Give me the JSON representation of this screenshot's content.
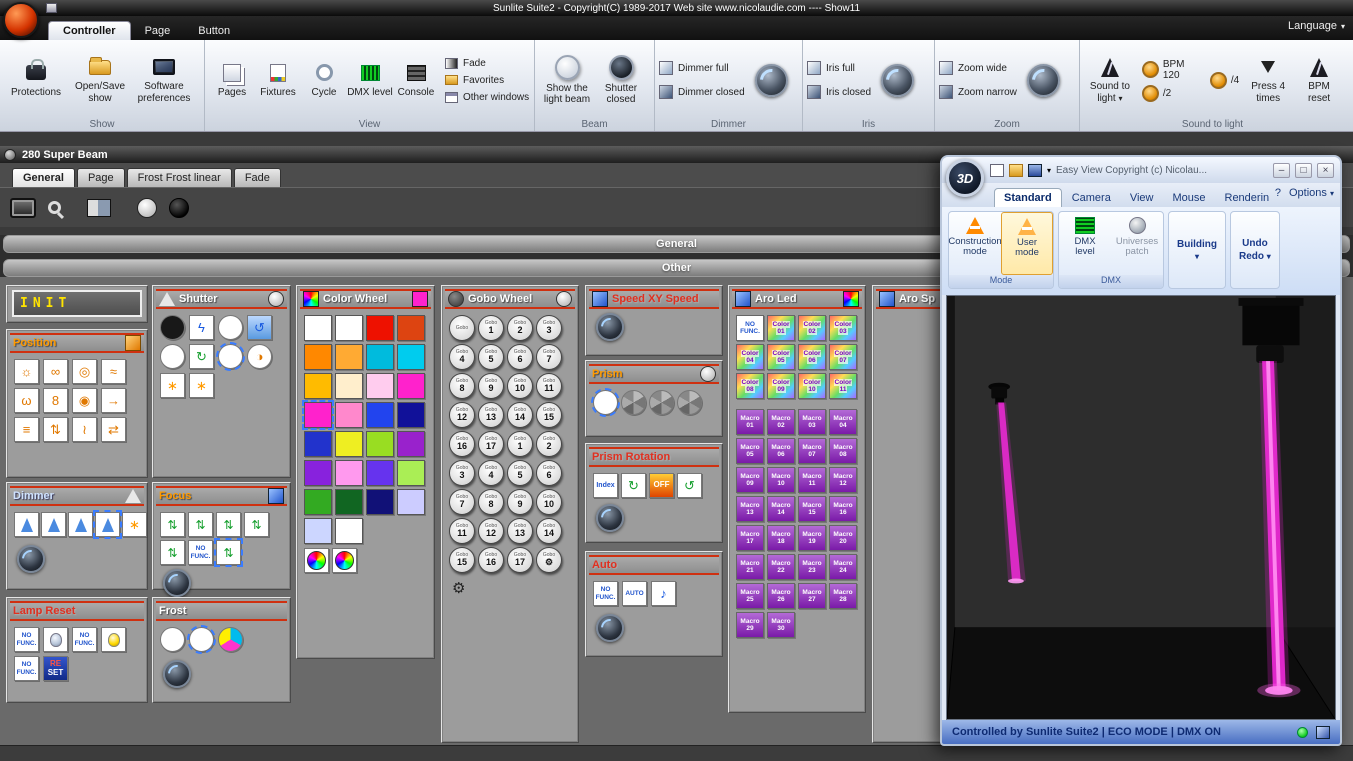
{
  "ui": {
    "caret": "▾"
  },
  "window": {
    "title": "Sunlite Suite2 - Copyright(C) 1989-2017    Web site www.nicolaudie.com ---- Show11"
  },
  "menubar": {
    "tabs": [
      {
        "label": "Controller",
        "active": true
      },
      {
        "label": "Page"
      },
      {
        "label": "Button"
      }
    ],
    "language": "Language"
  },
  "ribbon": {
    "show": {
      "label": "Show",
      "protections": "Protections",
      "open_save": "Open/Save show",
      "preferences": "Software preferences"
    },
    "view": {
      "label": "View",
      "pages": "Pages",
      "fixtures": "Fixtures",
      "cycle": "Cycle",
      "dmx_level": "DMX level",
      "console": "Console",
      "fade": "Fade",
      "favorites": "Favorites",
      "other_windows": "Other windows"
    },
    "beam": {
      "label": "Beam",
      "show_beam": "Show the light beam",
      "shutter_closed": "Shutter closed"
    },
    "dimmer": {
      "label": "Dimmer",
      "full": "Dimmer full",
      "closed": "Dimmer closed"
    },
    "iris": {
      "label": "Iris",
      "full": "Iris full",
      "closed": "Iris closed"
    },
    "zoom": {
      "label": "Zoom",
      "wide": "Zoom wide",
      "narrow": "Zoom narrow"
    },
    "sound": {
      "label": "Sound to light",
      "sound_to_light": "Sound to light",
      "bpm": "BPM 120",
      "div2": "/2",
      "div4": "/4",
      "press4": "Press 4 times",
      "bpm_reset": "BPM reset"
    }
  },
  "fixture": {
    "title": "280 Super Beam",
    "tabs": [
      {
        "label": "General",
        "active": true
      },
      {
        "label": "Page"
      },
      {
        "label": "Frost Frost linear"
      },
      {
        "label": "Fade"
      }
    ]
  },
  "sections": {
    "general": "General",
    "other": "Other"
  },
  "board": {
    "init": {
      "title": "INIT"
    },
    "position": {
      "title": "Position",
      "presets": [
        "☼",
        "∞",
        "◎",
        "≈",
        "ω",
        "8",
        "◉",
        "→",
        "≡",
        "⇅",
        "≀",
        "⇄"
      ]
    },
    "shutter": {
      "title": "Shutter",
      "cells": [
        {
          "name": "shutter-closed",
          "c": "#181818",
          "cls": "round"
        },
        {
          "name": "strobe-button",
          "g": "ϟ",
          "cls": "fg-blue"
        },
        {
          "name": "shutter-open",
          "c": "#ffffff",
          "cls": "round"
        },
        {
          "name": "strobe-random",
          "g": "↺",
          "cls": "fg-blue bg-blue"
        },
        {
          "name": "shutter-open-b",
          "c": "#ffffff",
          "cls": "round"
        },
        {
          "name": "strobe-sync",
          "g": "↻",
          "cls": "fg-green"
        },
        {
          "name": "shutter-open-selected",
          "c": "#ffffff",
          "cls": "round",
          "sel": true
        },
        {
          "name": "shutter-split",
          "c": "#ffffff",
          "cls": "round",
          "g": "◑"
        }
      ],
      "extra": [
        {
          "name": "shutter-pulse-open",
          "g": "∗",
          "cls": "fg-amber"
        },
        {
          "name": "shutter-pulse-close",
          "g": "∗",
          "cls": "fg-amber"
        }
      ]
    },
    "dimmer": {
      "title": "Dimmer",
      "cells": [
        {
          "name": "dimmer-beam-1",
          "cls": "beam"
        },
        {
          "name": "dimmer-beam-2",
          "cls": "beam"
        },
        {
          "name": "dimmer-beam-3",
          "cls": "beam"
        },
        {
          "name": "dimmer-beam-selected",
          "cls": "beam",
          "sel": true
        },
        {
          "name": "dimmer-strobe",
          "g": "∗",
          "cls": "fg-amber"
        }
      ]
    },
    "focus": {
      "title": "Focus",
      "cells": [
        {
          "name": "focus-1",
          "g": "⇅",
          "cls": "fic"
        },
        {
          "name": "focus-2",
          "g": "⇅",
          "cls": "fic"
        },
        {
          "name": "focus-3",
          "g": "⇅",
          "cls": "fic"
        },
        {
          "name": "focus-4",
          "g": "⇅",
          "cls": "fic"
        },
        {
          "name": "focus-5",
          "g": "⇅",
          "cls": "fic"
        },
        {
          "name": "focus-no-func",
          "l1": "NO",
          "l2": "FUNC."
        },
        {
          "name": "focus-selected",
          "g": "⇅",
          "cls": "fic",
          "sel": true
        }
      ]
    },
    "lamp_reset": {
      "title": "Lamp Reset",
      "cells": [
        {
          "name": "lamp-no-func-1",
          "l1": "NO",
          "l2": "FUNC."
        },
        {
          "name": "lamp-off-button",
          "cls": "bulb-dim"
        },
        {
          "name": "lamp-no-func-2",
          "l1": "NO",
          "l2": "FUNC."
        },
        {
          "name": "lamp-on-button",
          "cls": "bulb"
        },
        {
          "name": "lamp-no-func-3",
          "l1": "NO",
          "l2": "FUNC."
        },
        {
          "name": "reset-button",
          "l1": "RE",
          "l2": "SET",
          "cls": "reset"
        }
      ]
    },
    "frost": {
      "title": "Frost",
      "cells": [
        {
          "name": "frost-open",
          "c": "#ffffff",
          "cls": "round"
        },
        {
          "name": "frost-on-selected",
          "c": "#ffffff",
          "cls": "round",
          "sel": true
        },
        {
          "name": "frost-cmy",
          "cls": "cmy round"
        }
      ]
    },
    "color_wheel": {
      "title": "Color Wheel",
      "cells": [
        {
          "name": "color-01",
          "c": "#ffffff"
        },
        {
          "name": "color-02",
          "c": "#ffffff"
        },
        {
          "name": "color-03",
          "c": "#ee1100"
        },
        {
          "name": "color-04",
          "c": "#dd4411"
        },
        {
          "name": "color-05",
          "c": "#ff8800"
        },
        {
          "name": "color-06",
          "c": "#ffaa33"
        },
        {
          "name": "color-07",
          "c": "#00bbdd"
        },
        {
          "name": "color-08",
          "c": "#00ccee"
        },
        {
          "name": "color-09",
          "c": "#ffbb00"
        },
        {
          "name": "color-10",
          "c": "#ffeecc"
        },
        {
          "name": "color-11",
          "c": "#ffccee"
        },
        {
          "name": "color-12",
          "c": "#ff22cc"
        },
        {
          "name": "color-13-selected",
          "c": "#ff22cc",
          "sel": true
        },
        {
          "name": "color-14",
          "c": "#ff88cc"
        },
        {
          "name": "color-15",
          "c": "#2244ee"
        },
        {
          "name": "color-16",
          "c": "#111199"
        },
        {
          "name": "color-17",
          "c": "#2233cc"
        },
        {
          "name": "color-18",
          "c": "#eeee22"
        },
        {
          "name": "color-19",
          "c": "#99dd22"
        },
        {
          "name": "color-20",
          "c": "#9922cc"
        },
        {
          "name": "color-21",
          "c": "#8822dd"
        },
        {
          "name": "color-22",
          "c": "#ff99ee"
        },
        {
          "name": "color-23",
          "c": "#6633ee"
        },
        {
          "name": "color-24",
          "c": "#aaee55"
        },
        {
          "name": "color-25",
          "c": "#33aa22"
        },
        {
          "name": "color-26",
          "c": "#116622"
        },
        {
          "name": "color-27",
          "c": "#111177"
        },
        {
          "name": "color-28",
          "c": "#ccccff"
        },
        {
          "name": "color-29",
          "c": "#ccd6ff"
        },
        {
          "name": "color-30",
          "c": "#ffffff"
        }
      ],
      "wheels": [
        {
          "name": "rainbow-wheel-1",
          "cls": "wheel"
        },
        {
          "name": "rainbow-wheel-2",
          "cls": "wheel"
        }
      ]
    },
    "gobo_wheel": {
      "title": "Gobo Wheel",
      "knob_text": "Gobo",
      "gear": "⚙",
      "knobs": [
        {
          "n": ""
        },
        {
          "n": "1"
        },
        {
          "n": "2"
        },
        {
          "n": "3"
        },
        {
          "n": "4"
        },
        {
          "n": "5"
        },
        {
          "n": "6"
        },
        {
          "n": "7"
        },
        {
          "n": "8"
        },
        {
          "n": "9"
        },
        {
          "n": "10"
        },
        {
          "n": "11"
        },
        {
          "n": "12"
        },
        {
          "n": "13"
        },
        {
          "n": "14"
        },
        {
          "n": "15"
        },
        {
          "n": "16"
        },
        {
          "n": "17"
        },
        {
          "n": "1"
        },
        {
          "n": "2"
        },
        {
          "n": "3"
        },
        {
          "n": "4"
        },
        {
          "n": "5"
        },
        {
          "n": "6"
        },
        {
          "n": "7"
        },
        {
          "n": "8"
        },
        {
          "n": "9"
        },
        {
          "n": "10"
        },
        {
          "n": "11"
        },
        {
          "n": "12"
        },
        {
          "n": "13"
        },
        {
          "n": "14"
        },
        {
          "n": "15"
        },
        {
          "n": "16"
        },
        {
          "n": "17"
        },
        {
          "n": "⚙"
        }
      ]
    },
    "speed": {
      "title": "Speed XY Speed"
    },
    "prism": {
      "title": "Prism",
      "cells": [
        {
          "name": "prism-off-selected",
          "c": "#ffffff",
          "cls": "round",
          "sel": true
        },
        {
          "name": "prism-facet-1",
          "cls": "cone round"
        },
        {
          "name": "prism-facet-2",
          "cls": "cone round"
        },
        {
          "name": "prism-facet-3",
          "cls": "cone round"
        }
      ]
    },
    "prism_rotation": {
      "title": "Prism Rotation",
      "cells": [
        {
          "name": "prism-index",
          "l1": "Index",
          "cls": "idx"
        },
        {
          "name": "prism-rotate-cw",
          "g": "↻",
          "cls": "fg-green"
        },
        {
          "name": "prism-rotate-off",
          "l1": "OFF",
          "cls": "off"
        },
        {
          "name": "prism-rotate-ccw",
          "g": "↺",
          "cls": "fg-green"
        }
      ]
    },
    "auto": {
      "title": "Auto",
      "cells": [
        {
          "name": "auto-no-func",
          "l1": "NO",
          "l2": "FUNC."
        },
        {
          "name": "auto-program",
          "l1": "AUTO"
        },
        {
          "name": "music-mode",
          "g": "♪",
          "cls": "fg-blue"
        }
      ]
    },
    "aro_led": {
      "title": "Aro Led",
      "cells": [
        {
          "name": "aro-no-func",
          "l1": "NO",
          "l2": "FUNC.",
          "cls": "nf"
        },
        {
          "name": "aro-color-01",
          "l1": "Color",
          "l2": "01"
        },
        {
          "name": "aro-color-02",
          "l1": "Color",
          "l2": "02"
        },
        {
          "name": "aro-color-03",
          "l1": "Color",
          "l2": "03"
        },
        {
          "name": "aro-color-04",
          "l1": "Color",
          "l2": "04"
        },
        {
          "name": "aro-color-05",
          "l1": "Color",
          "l2": "05"
        },
        {
          "name": "aro-color-06",
          "l1": "Color",
          "l2": "06"
        },
        {
          "name": "aro-color-07",
          "l1": "Color",
          "l2": "07"
        },
        {
          "name": "aro-color-08",
          "l1": "Color",
          "l2": "08"
        },
        {
          "name": "aro-color-09",
          "l1": "Color",
          "l2": "09"
        },
        {
          "name": "aro-color-10",
          "l1": "Color",
          "l2": "10"
        },
        {
          "name": "aro-color-11",
          "l1": "Color",
          "l2": "11"
        }
      ],
      "macros": [
        {
          "l1": "Macro",
          "l2": "01",
          "cls": "mcell"
        },
        {
          "l1": "Macro",
          "l2": "02",
          "cls": "mcell"
        },
        {
          "l1": "Macro",
          "l2": "03",
          "cls": "mcell"
        },
        {
          "l1": "Macro",
          "l2": "04",
          "cls": "mcell"
        },
        {
          "l1": "Macro",
          "l2": "05",
          "cls": "mcell"
        },
        {
          "l1": "Macro",
          "l2": "06",
          "cls": "mcell"
        },
        {
          "l1": "Macro",
          "l2": "07",
          "cls": "mcell"
        },
        {
          "l1": "Macro",
          "l2": "08",
          "cls": "mcell"
        },
        {
          "l1": "Macro",
          "l2": "09",
          "cls": "mcell"
        },
        {
          "l1": "Macro",
          "l2": "10",
          "cls": "mcell"
        },
        {
          "l1": "Macro",
          "l2": "11",
          "cls": "mcell"
        },
        {
          "l1": "Macro",
          "l2": "12",
          "cls": "mcell"
        },
        {
          "l1": "Macro",
          "l2": "13",
          "cls": "mcell"
        },
        {
          "l1": "Macro",
          "l2": "14",
          "cls": "mcell"
        },
        {
          "l1": "Macro",
          "l2": "15",
          "cls": "mcell"
        },
        {
          "l1": "Macro",
          "l2": "16",
          "cls": "mcell"
        },
        {
          "l1": "Macro",
          "l2": "17",
          "cls": "mcell"
        },
        {
          "l1": "Macro",
          "l2": "18",
          "cls": "mcell"
        },
        {
          "l1": "Macro",
          "l2": "19",
          "cls": "mcell"
        },
        {
          "l1": "Macro",
          "l2": "20",
          "cls": "mcell"
        },
        {
          "l1": "Macro",
          "l2": "21",
          "cls": "mcell"
        },
        {
          "l1": "Macro",
          "l2": "22",
          "cls": "mcell"
        },
        {
          "l1": "Macro",
          "l2": "23",
          "cls": "mcell"
        },
        {
          "l1": "Macro",
          "l2": "24",
          "cls": "mcell"
        },
        {
          "l1": "Macro",
          "l2": "25",
          "cls": "mcell"
        },
        {
          "l1": "Macro",
          "l2": "26",
          "cls": "mcell"
        },
        {
          "l1": "Macro",
          "l2": "27",
          "cls": "mcell"
        },
        {
          "l1": "Macro",
          "l2": "28",
          "cls": "mcell"
        },
        {
          "l1": "Macro",
          "l2": "29",
          "cls": "mcell"
        },
        {
          "l1": "Macro",
          "l2": "30",
          "cls": "mcell"
        }
      ]
    },
    "aro_sp": {
      "title": "Aro Sp"
    }
  },
  "easyview": {
    "logo": "3D",
    "title": "Easy View  Copyright (c) Nicolau...",
    "win": {
      "min": "–",
      "max": "□",
      "close": "×"
    },
    "tabs": [
      {
        "label": "Standard",
        "active": true
      },
      {
        "label": "Camera"
      },
      {
        "label": "View"
      },
      {
        "label": "Mouse"
      },
      {
        "label": "Renderin"
      }
    ],
    "help": "?",
    "options": "Options",
    "groups": {
      "mode": "Mode",
      "dmx": "DMX"
    },
    "buttons": {
      "construction_1": "Construction",
      "construction_2": "mode",
      "user_1": "User",
      "user_2": "mode",
      "dmx_1": "DMX",
      "dmx_2": "level",
      "uni_1": "Universes",
      "uni_2": "patch",
      "building": "Building",
      "undo": "Undo",
      "redo": "Redo"
    },
    "status": {
      "text": "Controlled by Sunlite Suite2  |  ECO MODE  |  DMX ON"
    }
  }
}
